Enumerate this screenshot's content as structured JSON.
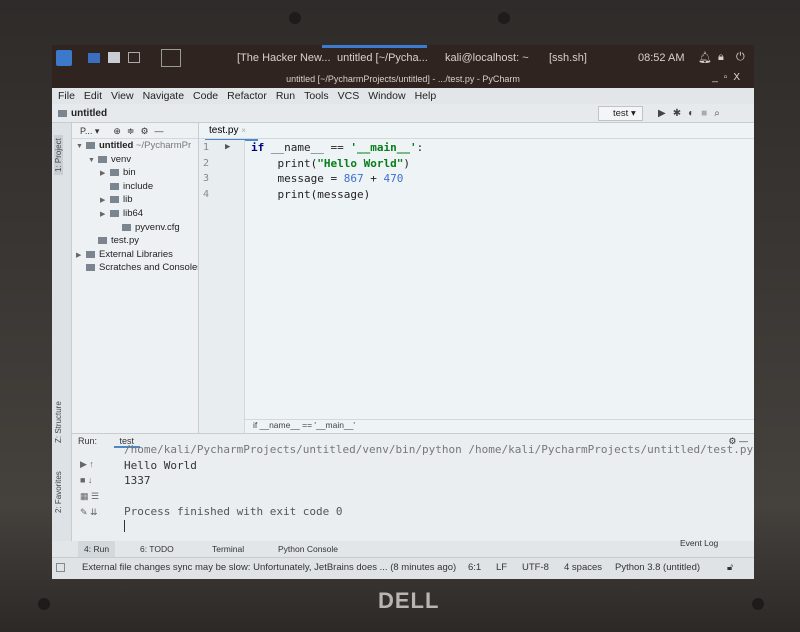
{
  "taskbar": {
    "apps": [
      "[The Hacker New...",
      "untitled [~/Pycha...",
      "kali@localhost: ~",
      "[ssh.sh]"
    ],
    "clock": "08:52 AM"
  },
  "window": {
    "title": "untitled [~/PycharmProjects/untitled] - .../test.py - PyCharm",
    "controls": [
      "_",
      "▫",
      "X"
    ]
  },
  "menu": [
    "File",
    "Edit",
    "View",
    "Navigate",
    "Code",
    "Refactor",
    "Run",
    "Tools",
    "VCS",
    "Window",
    "Help"
  ],
  "navbar": {
    "project": "untitled",
    "run_config": "test ▾"
  },
  "left_tools": {
    "project": "1: Project",
    "structure": "Z: Structure",
    "favorites": "2: Favorites"
  },
  "project_panel": {
    "header": "P... ▾",
    "tree": [
      {
        "label": "untitled",
        "suffix": " ~/PycharmPr",
        "level": 0,
        "arrow": "▼"
      },
      {
        "label": "venv",
        "level": 1,
        "arrow": "▼"
      },
      {
        "label": "bin",
        "level": 2,
        "arrow": "▶"
      },
      {
        "label": "include",
        "level": 2,
        "arrow": ""
      },
      {
        "label": "lib",
        "level": 2,
        "arrow": "▶"
      },
      {
        "label": "lib64",
        "level": 2,
        "arrow": "▶"
      },
      {
        "label": "pyvenv.cfg",
        "level": 3,
        "arrow": ""
      },
      {
        "label": "test.py",
        "level": 1,
        "arrow": ""
      },
      {
        "label": "External Libraries",
        "level": 0,
        "arrow": "▶"
      },
      {
        "label": "Scratches and Consoles",
        "level": 0,
        "arrow": ""
      }
    ]
  },
  "editor": {
    "tab": "test.py",
    "line_numbers": [
      "1",
      "2",
      "3",
      "4"
    ],
    "breadcrumb": "if __name__ == '__main__'"
  },
  "run_panel": {
    "label": "Run:",
    "tab": "test",
    "output": [
      "/home/kali/PycharmProjects/untitled/venv/bin/python /home/kali/PycharmProjects/untitled/test.py",
      "Hello World",
      "1337",
      "",
      "Process finished with exit code 0"
    ]
  },
  "bottom_tabs": [
    "4: Run",
    "6: TODO",
    "Terminal",
    "Python Console"
  ],
  "event_log": "Event Log",
  "status": {
    "message": "External file changes sync may be slow: Unfortunately, JetBrains does ... (8 minutes ago)",
    "position": "6:1",
    "line_sep": "LF",
    "encoding": "UTF-8",
    "indent": "4 spaces",
    "interpreter": "Python 3.8 (untitled)"
  },
  "brand": "DELL"
}
